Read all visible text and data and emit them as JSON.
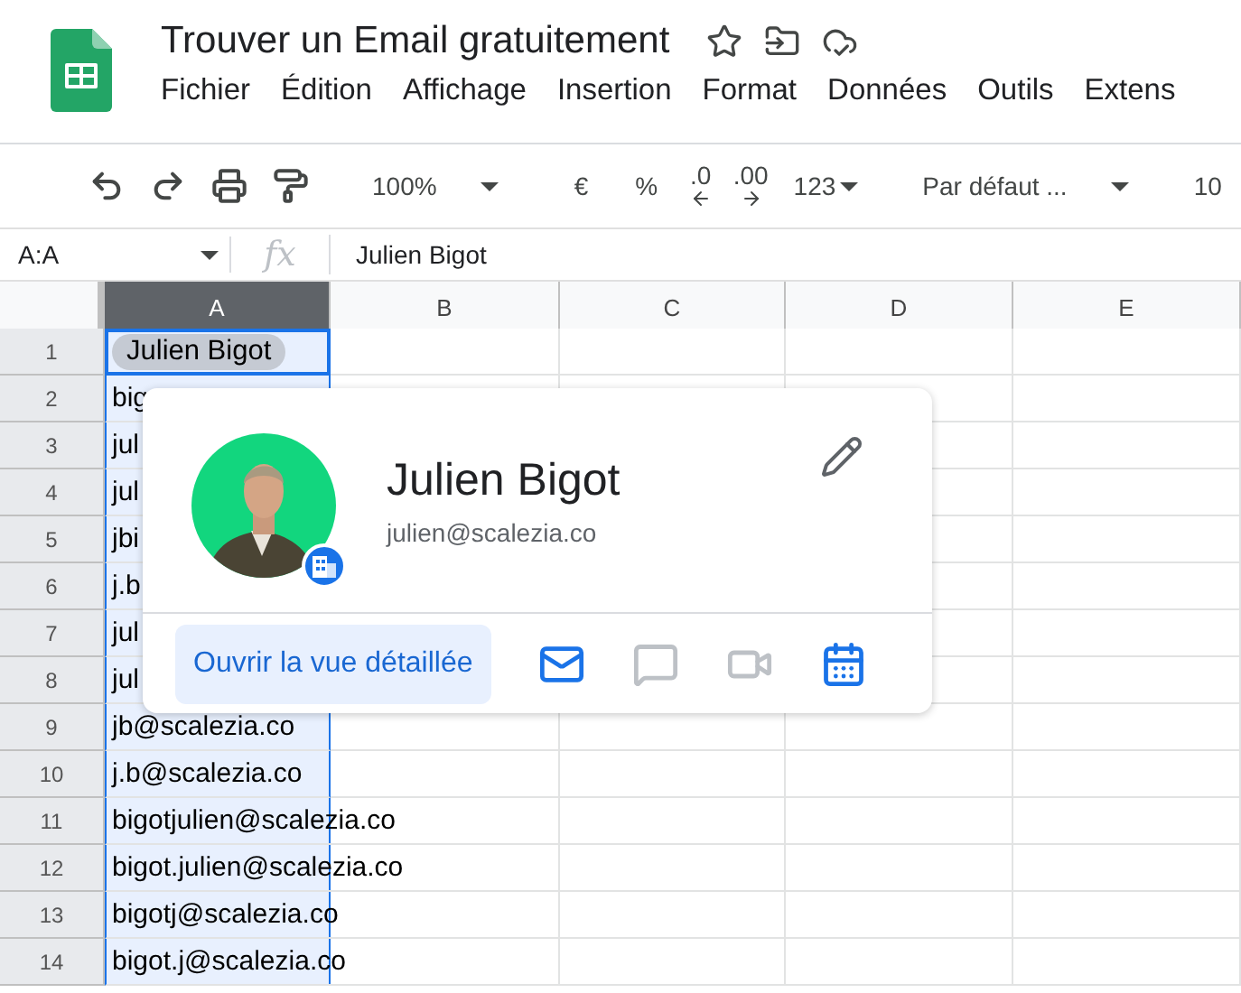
{
  "document": {
    "title": "Trouver un Email gratuitement"
  },
  "menu": [
    "Fichier",
    "Édition",
    "Affichage",
    "Insertion",
    "Format",
    "Données",
    "Outils",
    "Extens"
  ],
  "toolbar": [
    {
      "kind": "undo"
    },
    {
      "kind": "redo"
    },
    {
      "kind": "print"
    },
    {
      "kind": "paint"
    },
    {
      "kind": "sep"
    },
    {
      "kind": "dropdown",
      "label": "100%"
    },
    {
      "kind": "sep"
    },
    {
      "kind": "text",
      "label": "€"
    },
    {
      "kind": "text",
      "label": "%"
    },
    {
      "kind": "decleft",
      "label": ".0"
    },
    {
      "kind": "decright",
      "label": ".00"
    },
    {
      "kind": "compact-dropdown",
      "label": "123"
    },
    {
      "kind": "sep"
    },
    {
      "kind": "dropdown",
      "label": "Par défaut ..."
    },
    {
      "kind": "sep"
    },
    {
      "kind": "dropdown",
      "label": "10"
    }
  ],
  "formula_bar": {
    "name_box": "A:A",
    "fx": "fx",
    "value": "Julien Bigot"
  },
  "columns": [
    {
      "label": "A",
      "selected": true
    },
    {
      "label": "B",
      "selected": false
    },
    {
      "label": "C",
      "selected": false
    },
    {
      "label": "D",
      "selected": false
    },
    {
      "label": "E",
      "selected": false
    }
  ],
  "rows": [
    {
      "number": "1",
      "kind": "chip",
      "text": "Julien Bigot"
    },
    {
      "number": "2",
      "kind": "text",
      "text": "big"
    },
    {
      "number": "3",
      "kind": "text",
      "text": "jul"
    },
    {
      "number": "4",
      "kind": "text",
      "text": "jul"
    },
    {
      "number": "5",
      "kind": "text",
      "text": "jbi"
    },
    {
      "number": "6",
      "kind": "text",
      "text": "j.b"
    },
    {
      "number": "7",
      "kind": "text",
      "text": "jul"
    },
    {
      "number": "8",
      "kind": "text",
      "text": "jul"
    },
    {
      "number": "9",
      "kind": "text",
      "text": "jb@scalezia.co"
    },
    {
      "number": "10",
      "kind": "text",
      "text": "j.b@scalezia.co"
    },
    {
      "number": "11",
      "kind": "text",
      "text": "bigotjulien@scalezia.co"
    },
    {
      "number": "12",
      "kind": "text",
      "text": "bigot.julien@scalezia.co"
    },
    {
      "number": "13",
      "kind": "text",
      "text": "bigotj@scalezia.co"
    },
    {
      "number": "14",
      "kind": "text",
      "text": "bigot.j@scalezia.co"
    }
  ],
  "contact_card": {
    "name": "Julien Bigot",
    "email": "julien@scalezia.co",
    "open_button": "Ouvrir la vue détaillée",
    "actions": [
      {
        "kind": "mail",
        "disabled": false
      },
      {
        "kind": "chat",
        "disabled": true
      },
      {
        "kind": "video",
        "disabled": true
      },
      {
        "kind": "calendar",
        "disabled": false
      }
    ]
  }
}
